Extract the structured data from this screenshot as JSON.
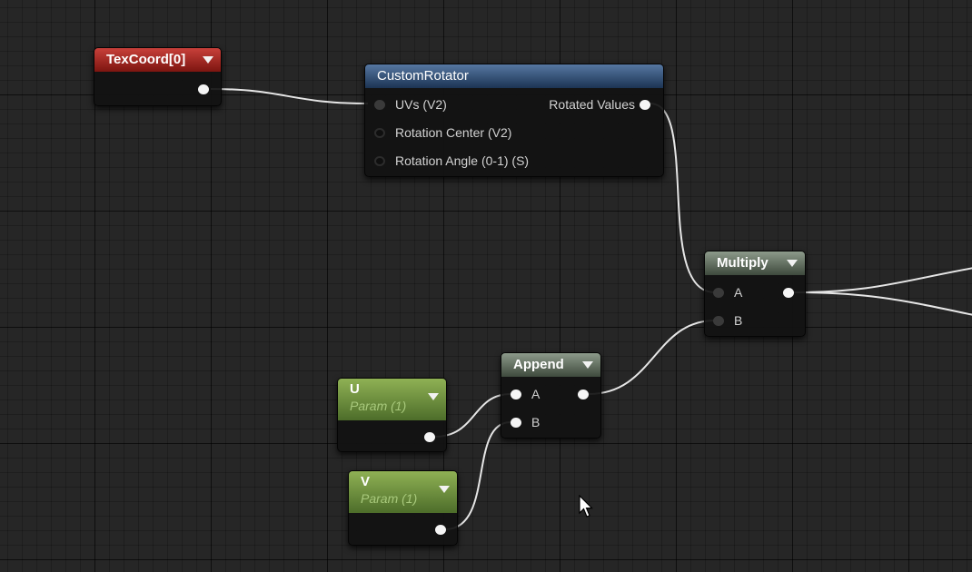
{
  "nodes": {
    "texcoord": {
      "title": "TexCoord[0]"
    },
    "custom_rotator": {
      "title": "CustomRotator",
      "inputs": [
        "UVs (V2)",
        "Rotation Center (V2)",
        "Rotation Angle (0-1) (S)"
      ],
      "output": "Rotated Values"
    },
    "multiply": {
      "title": "Multiply",
      "inputs": [
        "A",
        "B"
      ]
    },
    "append": {
      "title": "Append",
      "inputs": [
        "A",
        "B"
      ]
    },
    "param_u": {
      "title": "U",
      "subtitle": "Param (1)"
    },
    "param_v": {
      "title": "V",
      "subtitle": "Param (1)"
    }
  },
  "colors": {
    "texcoord_header": "#a3231d",
    "custom_header": "#35557c",
    "multiply_header": "#6b7a69",
    "append_header": "#6b7a69",
    "param_header": "#6e9140",
    "wire": "#e6e6e6",
    "grid_background": "#262626"
  },
  "icons": {
    "cursor": "mouse-pointer-icon"
  }
}
